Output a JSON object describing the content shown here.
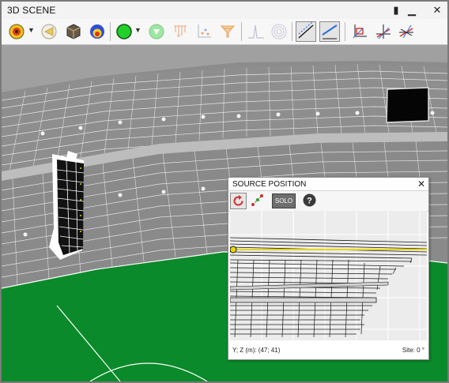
{
  "window": {
    "title": "3D SCENE",
    "controls": {
      "restore": "▮",
      "minimize": "▁",
      "close": "✕"
    }
  },
  "toolbar": {
    "items": [
      {
        "name": "source-target-icon",
        "dropdown": true
      },
      {
        "name": "speaker-beam-icon"
      },
      {
        "name": "cube-icon"
      },
      {
        "name": "coverage-map-icon"
      },
      {
        "name": "green-circle-icon",
        "dropdown": true
      },
      {
        "name": "green-arrow-down-icon"
      },
      {
        "name": "receiver-grid-icon"
      },
      {
        "name": "scatter-axes-icon"
      },
      {
        "name": "funnel-icon"
      },
      {
        "name": "impulse-response-icon"
      },
      {
        "name": "polar-pattern-icon"
      },
      {
        "name": "diagonal-line-dotted-icon",
        "pressed": true
      },
      {
        "name": "diagonal-line-solid-icon",
        "pressed": true
      },
      {
        "name": "axis-xy-icon"
      },
      {
        "name": "axis-xz-icon"
      },
      {
        "name": "axis-yz-icon"
      }
    ]
  },
  "source_panel": {
    "title": "SOURCE POSITION",
    "close": "✕",
    "solo_label": "SOLO",
    "help_label": "?",
    "coordinates": "Y; Z (m): (47; 41)",
    "site": "Site: 0 °"
  },
  "colors": {
    "pitch": "#0a8a2a",
    "stand_bg": "#8a8a8a",
    "highlight": "#e8d800",
    "accent": "#2a6fd6"
  }
}
